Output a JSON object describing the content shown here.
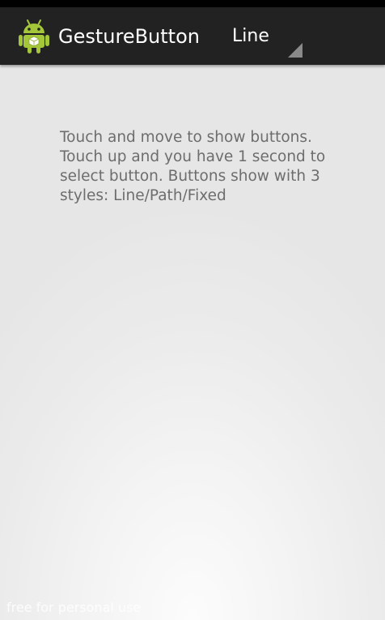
{
  "action_bar": {
    "icon": "android-robot-icon",
    "title": "GestureButton",
    "style_spinner": {
      "selected": "Line"
    }
  },
  "main": {
    "instructions": "Touch and move to show buttons. Touch up and you have 1 second to select button. Buttons show with 3 styles: Line/Path/Fixed"
  },
  "watermark": "free for personal use",
  "colors": {
    "action_bar_bg": "#222222",
    "title_text": "#ffffff",
    "body_text": "#6d6d6d",
    "android_green": "#a4c639"
  }
}
